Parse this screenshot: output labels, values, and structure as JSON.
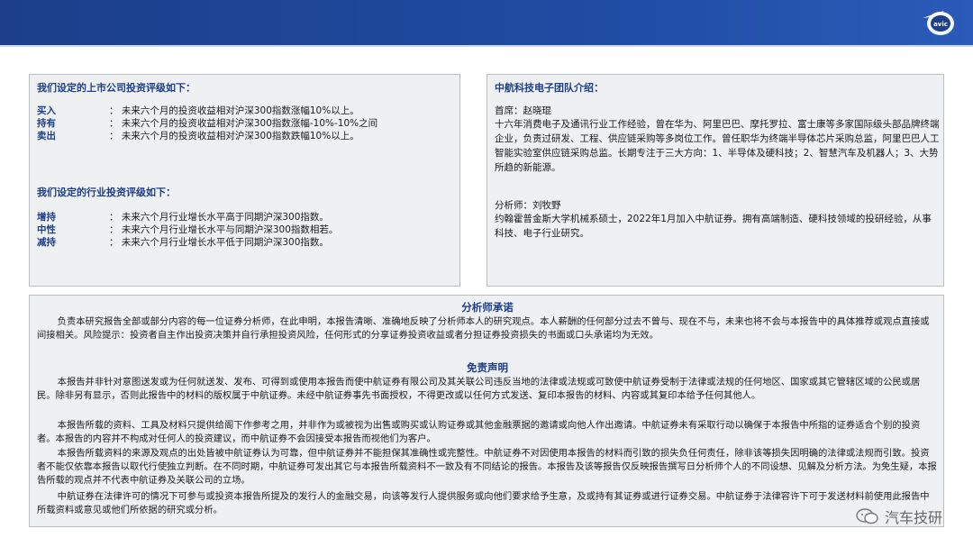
{
  "logo": {
    "text": "avic"
  },
  "left": {
    "company_title": "我们设定的上市公司投资评级如下：",
    "company_ratings": [
      {
        "label": "买入",
        "desc": "：  未来六个月的投资收益相对沪深300指数涨幅10%以上。"
      },
      {
        "label": "持有",
        "desc": "：  未来六个月的投资收益相对沪深300指数涨幅-10%-10%之间"
      },
      {
        "label": "卖出",
        "desc": "：  未来六个月的投资收益相对沪深300指数跌幅10%以上。"
      }
    ],
    "industry_title": "我们设定的行业投资评级如下：",
    "industry_ratings": [
      {
        "label": "增持",
        "desc": "：  未来六个月行业增长水平高于同期沪深300指数。"
      },
      {
        "label": "中性",
        "desc": "：  未来六个月行业增长水平与同期沪深300指数相若。"
      },
      {
        "label": "减持",
        "desc": "：  未来六个月行业增长水平低于同期沪深300指数。"
      }
    ]
  },
  "right": {
    "title": "中航科技电子团队介绍：",
    "chief_name": "首席：赵晓琨",
    "chief_bio": "十六年消费电子及通讯行业工作经验，曾在华为、阿里巴巴、摩托罗拉、富士康等多家国际级头部品牌终端企业，负责过研发、工程、供应链采购等多岗位工作。曾任职华为终端半导体芯片采购总监，阿里巴巴人工智能实验室供应链采购总监。长期专注于三大方向：1、半导体及硬科技；2、智慧汽车及机器人；3、大势所趋的新能源。",
    "analyst_name": "分析师：刘牧野",
    "analyst_bio": "约翰霍普金斯大学机械系硕士，2022年1月加入中航证券。拥有高端制造、硬科技领域的投研经验，从事科技、电子行业研究。"
  },
  "bottom": {
    "commit_title": "分析师承诺",
    "commit_text": "负责本研究报告全部或部分内容的每一位证券分析师，在此申明，本报告清晰、准确地反映了分析师本人的研究观点。本人薪酬的任何部分过去不曾与、现在不与，未来也将不会与本报告中的具体推荐或观点直接或间接相关。风险提示：投资者自主作出投资决策并自行承担投资风险，任何形式的分享证券投资收益或者分担证券投资损失的书面或口头承诺均为无效。",
    "disclaimer_title": "免责声明",
    "disclaimer_paras": [
      "本报告并非针对意图送发或为任何就送发、发布、可得到或使用本报告而使中航证券有限公司及其关联公司违反当地的法律或法规或可致使中航证券受制于法律或法规的任何地区、国家或其它管辖区域的公民或居民。除非另有显示，否则此报告中的材料的版权属于中航证券。未经中航证券事先书面授权，不得更改或以任何方式发送、复印本报告的材料、内容或其复印本给予任何其他人。",
      "本报告所载的资料、工具及材料只提供给阁下作参考之用，并非作为或被视为出售或购买或认购证券或其他金融票据的邀请或向他人作出邀请。中航证券未有采取行动以确保于本报告中所指的证券适合个别的投资者。本报告的内容并不构成对任何人的投资建议，而中航证券不会因接受本报告而视他们为客户。",
      "本报告所载资料的来源及观点的出处皆被中航证券认为可靠，但中航证券并不能担保其准确性或完整性。中航证券不对因使用本报告的材料而引致的损失负任何责任，除非该等损失因明确的法律或法规而引致。投资者不能仅依靠本报告以取代行使独立判断。在不同时期，中航证券可发出其它与本报告所载资料不一致及有不同结论的报告。本报告及该等报告仅反映报告撰写日分析师个人的不同设想、见解及分析方法。为免生疑，本报告所载的观点并不代表中航证券及关联公司的立场。",
      "中航证券在法律许可的情况下可参与或投资本报告所提及的发行人的金融交易，向该等发行人提供服务或向他们要求给予生意，及或持有其证券或进行证券交易。中航证券于法律容许下可于发送材料前使用此报告中所载资料或意见或他们所依据的研究或分析。"
    ]
  },
  "watermark": {
    "text": "汽车技研"
  }
}
